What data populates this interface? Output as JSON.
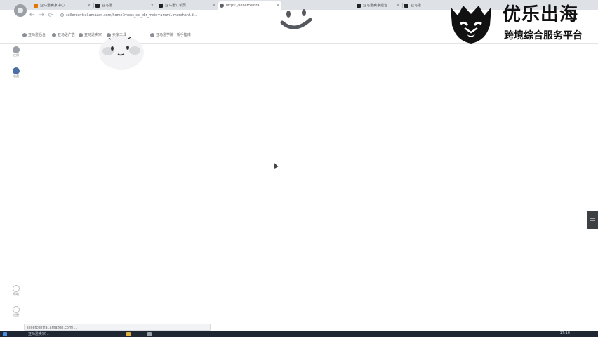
{
  "browser": {
    "logo": "browser-logo-icon",
    "tabs": [
      {
        "title": "亚马逊卖家中心 ...",
        "favicon_color": "#e37400",
        "active": false
      },
      {
        "title": "亚马逊",
        "favicon_color": "#222222",
        "active": false
      },
      {
        "title": "亚马逊订单页",
        "favicon_color": "#222222",
        "active": false
      },
      {
        "title": "https://sellercentral...",
        "favicon_color": "#5f6368",
        "active": true
      },
      {
        "title": "亚马逊卖家后台",
        "favicon_color": "#222222",
        "active": false
      },
      {
        "title": "亚马逊",
        "favicon_color": "#222222",
        "active": false
      }
    ],
    "nav": {
      "back": "←",
      "forward": "→",
      "reload": "⟳",
      "home": "⌂"
    },
    "address": "sellercentral.amazon.com/home?mons_sel_dir_mcid=amzn1.merchant.d...",
    "bookmarks": [
      "亚马逊后台",
      "亚马逊广告",
      "亚马逊卖家",
      "卖家工具",
      "亚马逊学院 · 新手指南"
    ]
  },
  "rail": [
    {
      "label": "应用",
      "icon": "apps-icon",
      "color": "#9aa0a6"
    },
    {
      "label": "收藏",
      "icon": "bookmark-icon",
      "color": "#4a6fa5"
    },
    {
      "label": "帮助",
      "icon": "help-icon",
      "color": "#bdbdbd"
    },
    {
      "label": "设置",
      "icon": "settings-icon",
      "color": "#bdbdbd"
    }
  ],
  "status_url": "sellercentral.amazon.com/...",
  "taskbar": {
    "items": [
      "亚马逊卖家...",
      "文件夹",
      "浏览器"
    ],
    "clock": "17:10"
  },
  "watermark": {
    "title": "优乐出海",
    "subtitle": "跨境综合服务平台",
    "logo": "lion-logo-icon"
  },
  "colors": {
    "tabstrip": "#dee1e6",
    "accent": "#4a6fa5",
    "taskbar": "#1f2733"
  }
}
